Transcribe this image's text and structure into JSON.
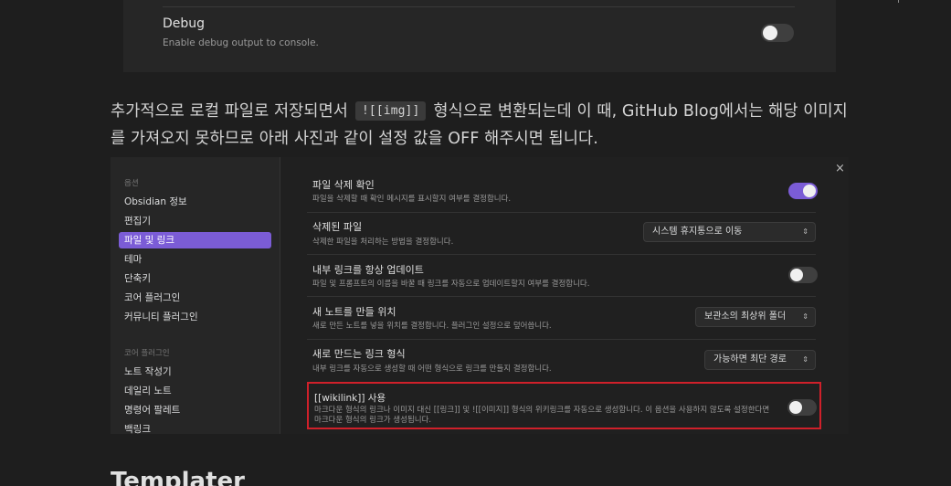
{
  "top_setting": {
    "name": "Debug",
    "description": "Enable debug output to console.",
    "toggle_on": false
  },
  "paragraph": {
    "before": "추가적으로 로컬 파일로 저장되면서",
    "code": "![[img]]",
    "after": "형식으로 변환되는데 이 때, GitHub Blog에서는 해당 이미지를 가져오지 못하므로 아래 사진과 같이 설정 값을 OFF 해주시면 됩니다."
  },
  "screenshot": {
    "close_label": "×",
    "sidebar": {
      "group1_title": "옵션",
      "group1_items": [
        "Obsidian 정보",
        "편집기",
        "파일 및 링크",
        "테마",
        "단축키",
        "코어 플러그인",
        "커뮤니티 플러그인"
      ],
      "active_item": "파일 및 링크",
      "group2_title": "코어 플러그인",
      "group2_items": [
        "노트 작성기",
        "데일리 노트",
        "명령어 팔레트",
        "백링크"
      ]
    },
    "settings": [
      {
        "name": "파일 삭제 확인",
        "description": "파일을 삭제할 때 확인 메시지를 표시할지 여부를 결정합니다.",
        "control": "toggle",
        "toggle_on": true
      },
      {
        "name": "삭제된 파일",
        "description": "삭제한 파일을 처리하는 방법을 결정합니다.",
        "control": "dropdown",
        "value": "시스템 휴지통으로 이동"
      },
      {
        "name": "내부 링크를 항상 업데이트",
        "description": "파일 및 프롬프트의 이름을 바꿀 때 링크를 자동으로 업데이트할지 여부를 결정합니다.",
        "control": "toggle",
        "toggle_on": false
      },
      {
        "name": "새 노트를 만들 위치",
        "description": "새로 만든 노트를 넣을 위치를 결정합니다. 플러그인 설정으로 덮어씁니다.",
        "control": "dropdown",
        "value": "보관소의 최상위 폴더"
      },
      {
        "name": "새로 만드는 링크 형식",
        "description": "내부 링크를 자동으로 생성할 때 어떤 형식으로 링크를 만들지 결정합니다.",
        "control": "dropdown",
        "value": "가능하면 최단 경로"
      }
    ],
    "highlighted_setting": {
      "name": "[[wikilink]] 사용",
      "description": "마크다운 형식의 링크나 이미지 대신 [[링크]] 및 ![[이미지]] 형식의 위키링크를 자동으로 생성합니다. 이 옵션을 사용하지 않도록 설정한다면 마크다운 형식의 링크가 생성됩니다.",
      "toggle_on": false
    },
    "colors": {
      "accent": "#7b5cd6",
      "highlight_border": "#d0202a"
    }
  },
  "next_heading": "Templater"
}
